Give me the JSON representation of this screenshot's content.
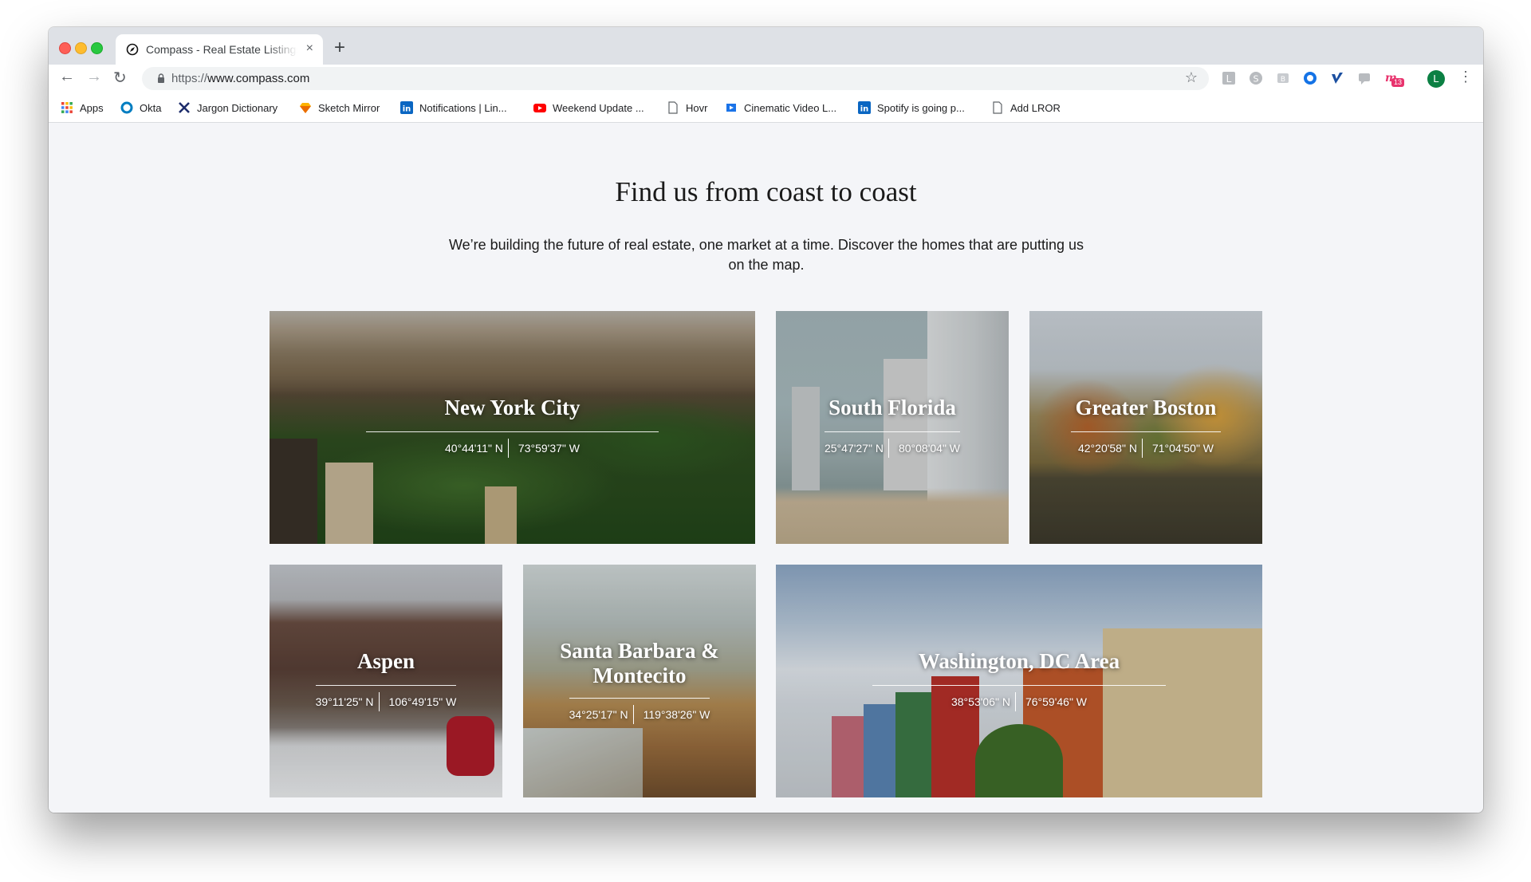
{
  "browser": {
    "tab_title": "Compass - Real Estate Listings",
    "tab_close": "×",
    "new_tab": "+",
    "url_scheme": "https://",
    "url_host": "www.compass.com",
    "back": "←",
    "forward": "→",
    "reload": "↻",
    "star": "☆",
    "menu": "⋮",
    "profile_initial": "L",
    "ext_badge": "13"
  },
  "bookmarks": [
    {
      "label": "Apps",
      "icon": "apps-grid-icon"
    },
    {
      "label": "Okta",
      "icon": "okta-icon"
    },
    {
      "label": "Jargon Dictionary",
      "icon": "jargon-icon"
    },
    {
      "label": "Sketch Mirror",
      "icon": "sketch-icon"
    },
    {
      "label": "Notifications | Lin...",
      "icon": "linkedin-icon"
    },
    {
      "label": "Weekend Update ...",
      "icon": "youtube-icon"
    },
    {
      "label": "Hovr",
      "icon": "page-icon"
    },
    {
      "label": "Cinematic Video L...",
      "icon": "video-icon"
    },
    {
      "label": "Spotify is going p...",
      "icon": "linkedin-icon"
    },
    {
      "label": "Add LROR",
      "icon": "page-icon"
    }
  ],
  "page": {
    "headline": "Find us from coast to coast",
    "subhead": "We’re building the future of real estate, one market at a time. Discover the homes that are putting us on the map."
  },
  "markets": [
    {
      "name": "New York City",
      "lat": "40°44'11\" N",
      "lon": "73°59'37\" W"
    },
    {
      "name": "South Florida",
      "lat": "25°47'27\" N",
      "lon": "80°08'04\" W"
    },
    {
      "name": "Greater Boston",
      "lat": "42°20'58\" N",
      "lon": "71°04'50\" W"
    },
    {
      "name": "Aspen",
      "lat": "39°11'25\" N",
      "lon": "106°49'15\" W"
    },
    {
      "name": "Santa Barbara & Montecito",
      "lat": "34°25'17\" N",
      "lon": "119°38'26\" W"
    },
    {
      "name": "Washington, DC Area",
      "lat": "38°53'06\" N",
      "lon": "76°59'46\" W"
    }
  ],
  "colors": {
    "page_bg": "#f4f5f8",
    "tabstrip": "#dee1e6",
    "text": "#1a1a1a"
  }
}
